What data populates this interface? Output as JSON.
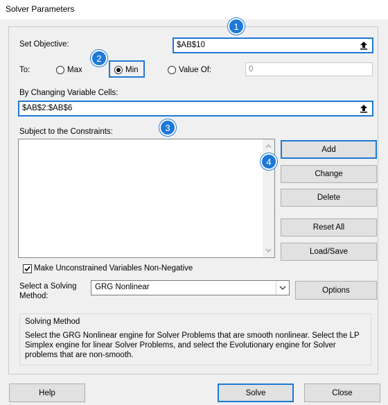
{
  "window": {
    "title": "Solver Parameters"
  },
  "objective": {
    "label": "Set Objective:",
    "value": "$AB$10"
  },
  "to": {
    "label": "To:",
    "max_label": "Max",
    "min_label": "Min",
    "value_of_label": "Value Of:",
    "value_of_value": "0",
    "selected": "Min"
  },
  "changing": {
    "label": "By Changing Variable Cells:",
    "value": "$AB$2:$AB$6"
  },
  "constraints": {
    "label": "Subject to the Constraints:",
    "items": []
  },
  "buttons": {
    "add": "Add",
    "change": "Change",
    "delete": "Delete",
    "reset_all": "Reset All",
    "load_save": "Load/Save",
    "options": "Options",
    "help": "Help",
    "solve": "Solve",
    "close": "Close"
  },
  "nonneg": {
    "label": "Make Unconstrained Variables Non-Negative",
    "checked": true
  },
  "method": {
    "label_line1": "Select a Solving",
    "label_line2": "Method:",
    "value": "GRG Nonlinear"
  },
  "solving_method": {
    "title": "Solving Method",
    "text": "Select the GRG Nonlinear engine for Solver Problems that are smooth nonlinear. Select the LP Simplex engine for linear Solver Problems, and select the Evolutionary engine for Solver problems that are non-smooth."
  },
  "badges": [
    "1",
    "2",
    "3",
    "4"
  ],
  "colors": {
    "accent": "#1e78d7"
  }
}
